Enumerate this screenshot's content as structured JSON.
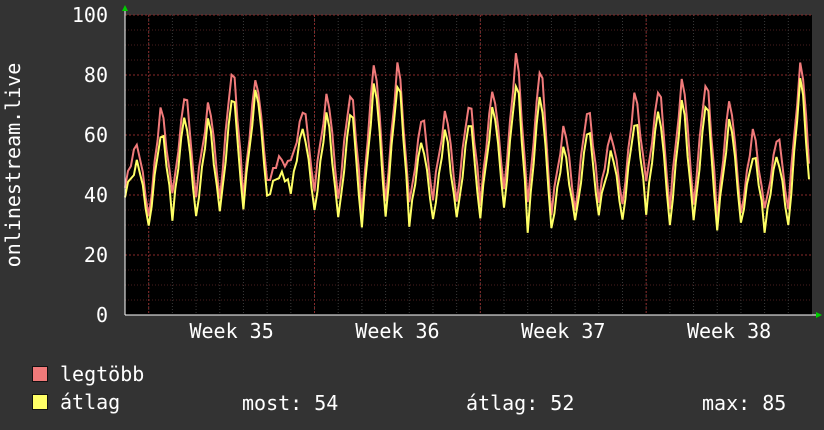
{
  "chart_data": {
    "type": "line",
    "ylabel": "onlinestream.live",
    "xlabel": "",
    "ylim": [
      0,
      100
    ],
    "yticks": [
      0,
      20,
      40,
      60,
      80,
      100
    ],
    "x_tick_labels": [
      "Week 35",
      "Week 36",
      "Week 37",
      "Week 38"
    ],
    "grid": true,
    "days": 29,
    "series": [
      {
        "name": "legtöbb",
        "color": "#f07a7a",
        "daily_low": [
          44,
          33,
          39,
          40,
          38,
          40,
          45,
          50,
          42,
          38,
          35,
          38,
          36,
          39,
          37,
          38,
          42,
          36,
          34,
          34,
          39,
          37,
          43,
          36,
          36,
          33,
          34,
          34,
          36
        ],
        "daily_peak": [
          58,
          71,
          76,
          73,
          86,
          82,
          52,
          70,
          76,
          78,
          88,
          87,
          68,
          70,
          74,
          78,
          90,
          86,
          65,
          72,
          62,
          76,
          78,
          82,
          82,
          75,
          63,
          61,
          88
        ]
      },
      {
        "name": "átlag",
        "color": "#ffff66",
        "daily_low": [
          40,
          29,
          33,
          33,
          33,
          36,
          39,
          42,
          35,
          31,
          30,
          32,
          31,
          32,
          31,
          33,
          35,
          29,
          29,
          30,
          34,
          31,
          35,
          30,
          30,
          29,
          30,
          29,
          30
        ],
        "daily_peak": [
          52,
          64,
          69,
          67,
          76,
          78,
          48,
          64,
          69,
          71,
          81,
          82,
          60,
          63,
          67,
          72,
          82,
          77,
          57,
          64,
          56,
          68,
          71,
          74,
          74,
          68,
          56,
          55,
          82
        ]
      }
    ]
  },
  "legend": {
    "max_label": "legtöbb",
    "avg_label": "átlag",
    "now_label": "most:",
    "now_value": "54",
    "avg_stat_label": "átlag:",
    "avg_value": "52",
    "max_stat_label": "max:",
    "max_value": "85"
  }
}
